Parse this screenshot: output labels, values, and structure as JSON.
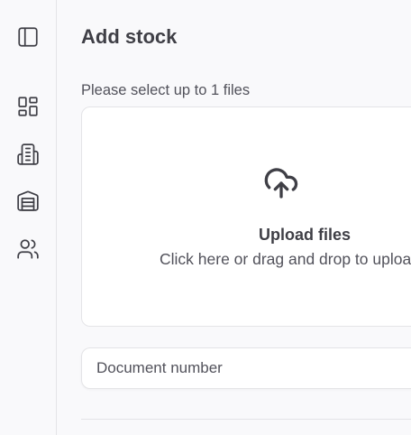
{
  "sidebar": {
    "items": [
      {
        "name": "toggle-sidebar",
        "icon": "sidebar-toggle-icon"
      },
      {
        "name": "dashboard",
        "icon": "dashboard-grid-icon"
      },
      {
        "name": "buildings",
        "icon": "building-icon"
      },
      {
        "name": "warehouse",
        "icon": "warehouse-icon"
      },
      {
        "name": "users",
        "icon": "users-icon"
      }
    ]
  },
  "page": {
    "title": "Add stock"
  },
  "upload": {
    "hint": "Please select up to 1 files",
    "icon": "cloud-upload-icon",
    "title": "Upload files",
    "subtitle": "Click here or drag and drop to upload"
  },
  "form": {
    "document_number_placeholder": "Document number"
  },
  "colors": {
    "background": "#f9f9fb",
    "text": "#3f3f46",
    "border": "#e4e4e7",
    "surface": "#ffffff"
  }
}
